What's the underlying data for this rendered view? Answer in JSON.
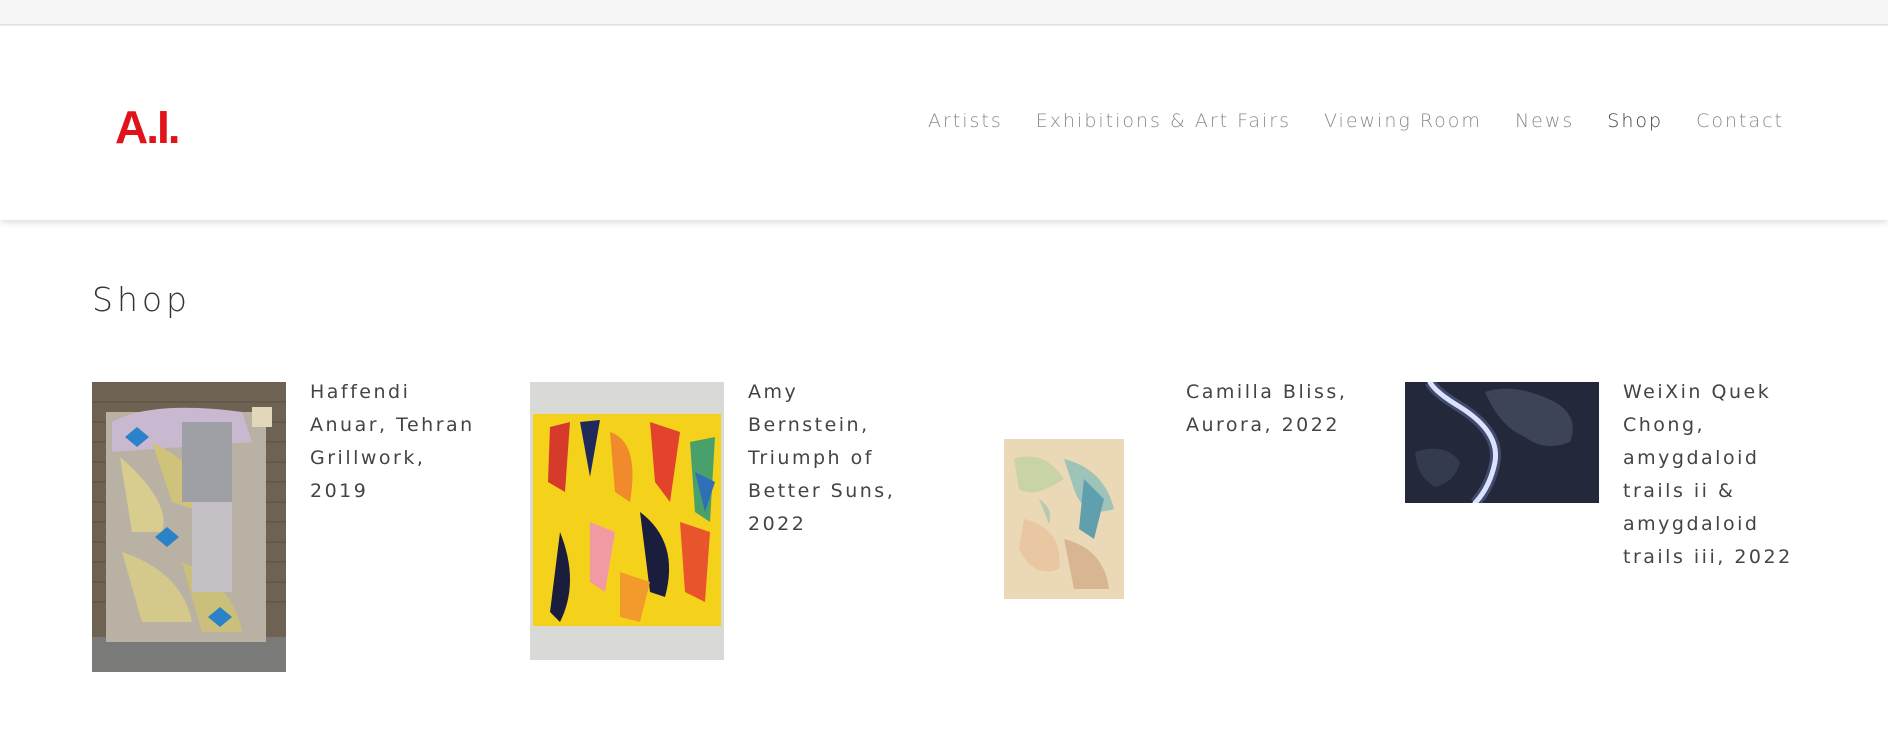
{
  "brand": {
    "logo_text": "A.I.",
    "logo_color": "#e0131b"
  },
  "nav": {
    "items": [
      {
        "label": "Artists",
        "active": false
      },
      {
        "label": "Exhibitions & Art Fairs",
        "active": false
      },
      {
        "label": "Viewing Room",
        "active": false
      },
      {
        "label": "News",
        "active": false
      },
      {
        "label": "Shop",
        "active": true
      },
      {
        "label": "Contact",
        "active": false
      }
    ]
  },
  "page": {
    "title": "Shop"
  },
  "products": [
    {
      "lines": [
        "Haffendi",
        "Anuar, Tehran",
        "Grillwork,",
        "2019"
      ],
      "artwork": "grillwork-collage"
    },
    {
      "lines": [
        "Amy",
        "Bernstein,",
        "Triumph of",
        "Better Suns,",
        "2022"
      ],
      "artwork": "abstract-yellow-painting"
    },
    {
      "lines": [
        "Camilla Bliss,",
        "Aurora, 2022"
      ],
      "artwork": "pale-abstract-painting"
    },
    {
      "lines": [
        "WeiXin Quek",
        "Chong,",
        "amygdaloid",
        "trails ii &",
        "amygdaloid",
        "trails iii, 2022"
      ],
      "artwork": "dark-neon-line-work"
    }
  ]
}
